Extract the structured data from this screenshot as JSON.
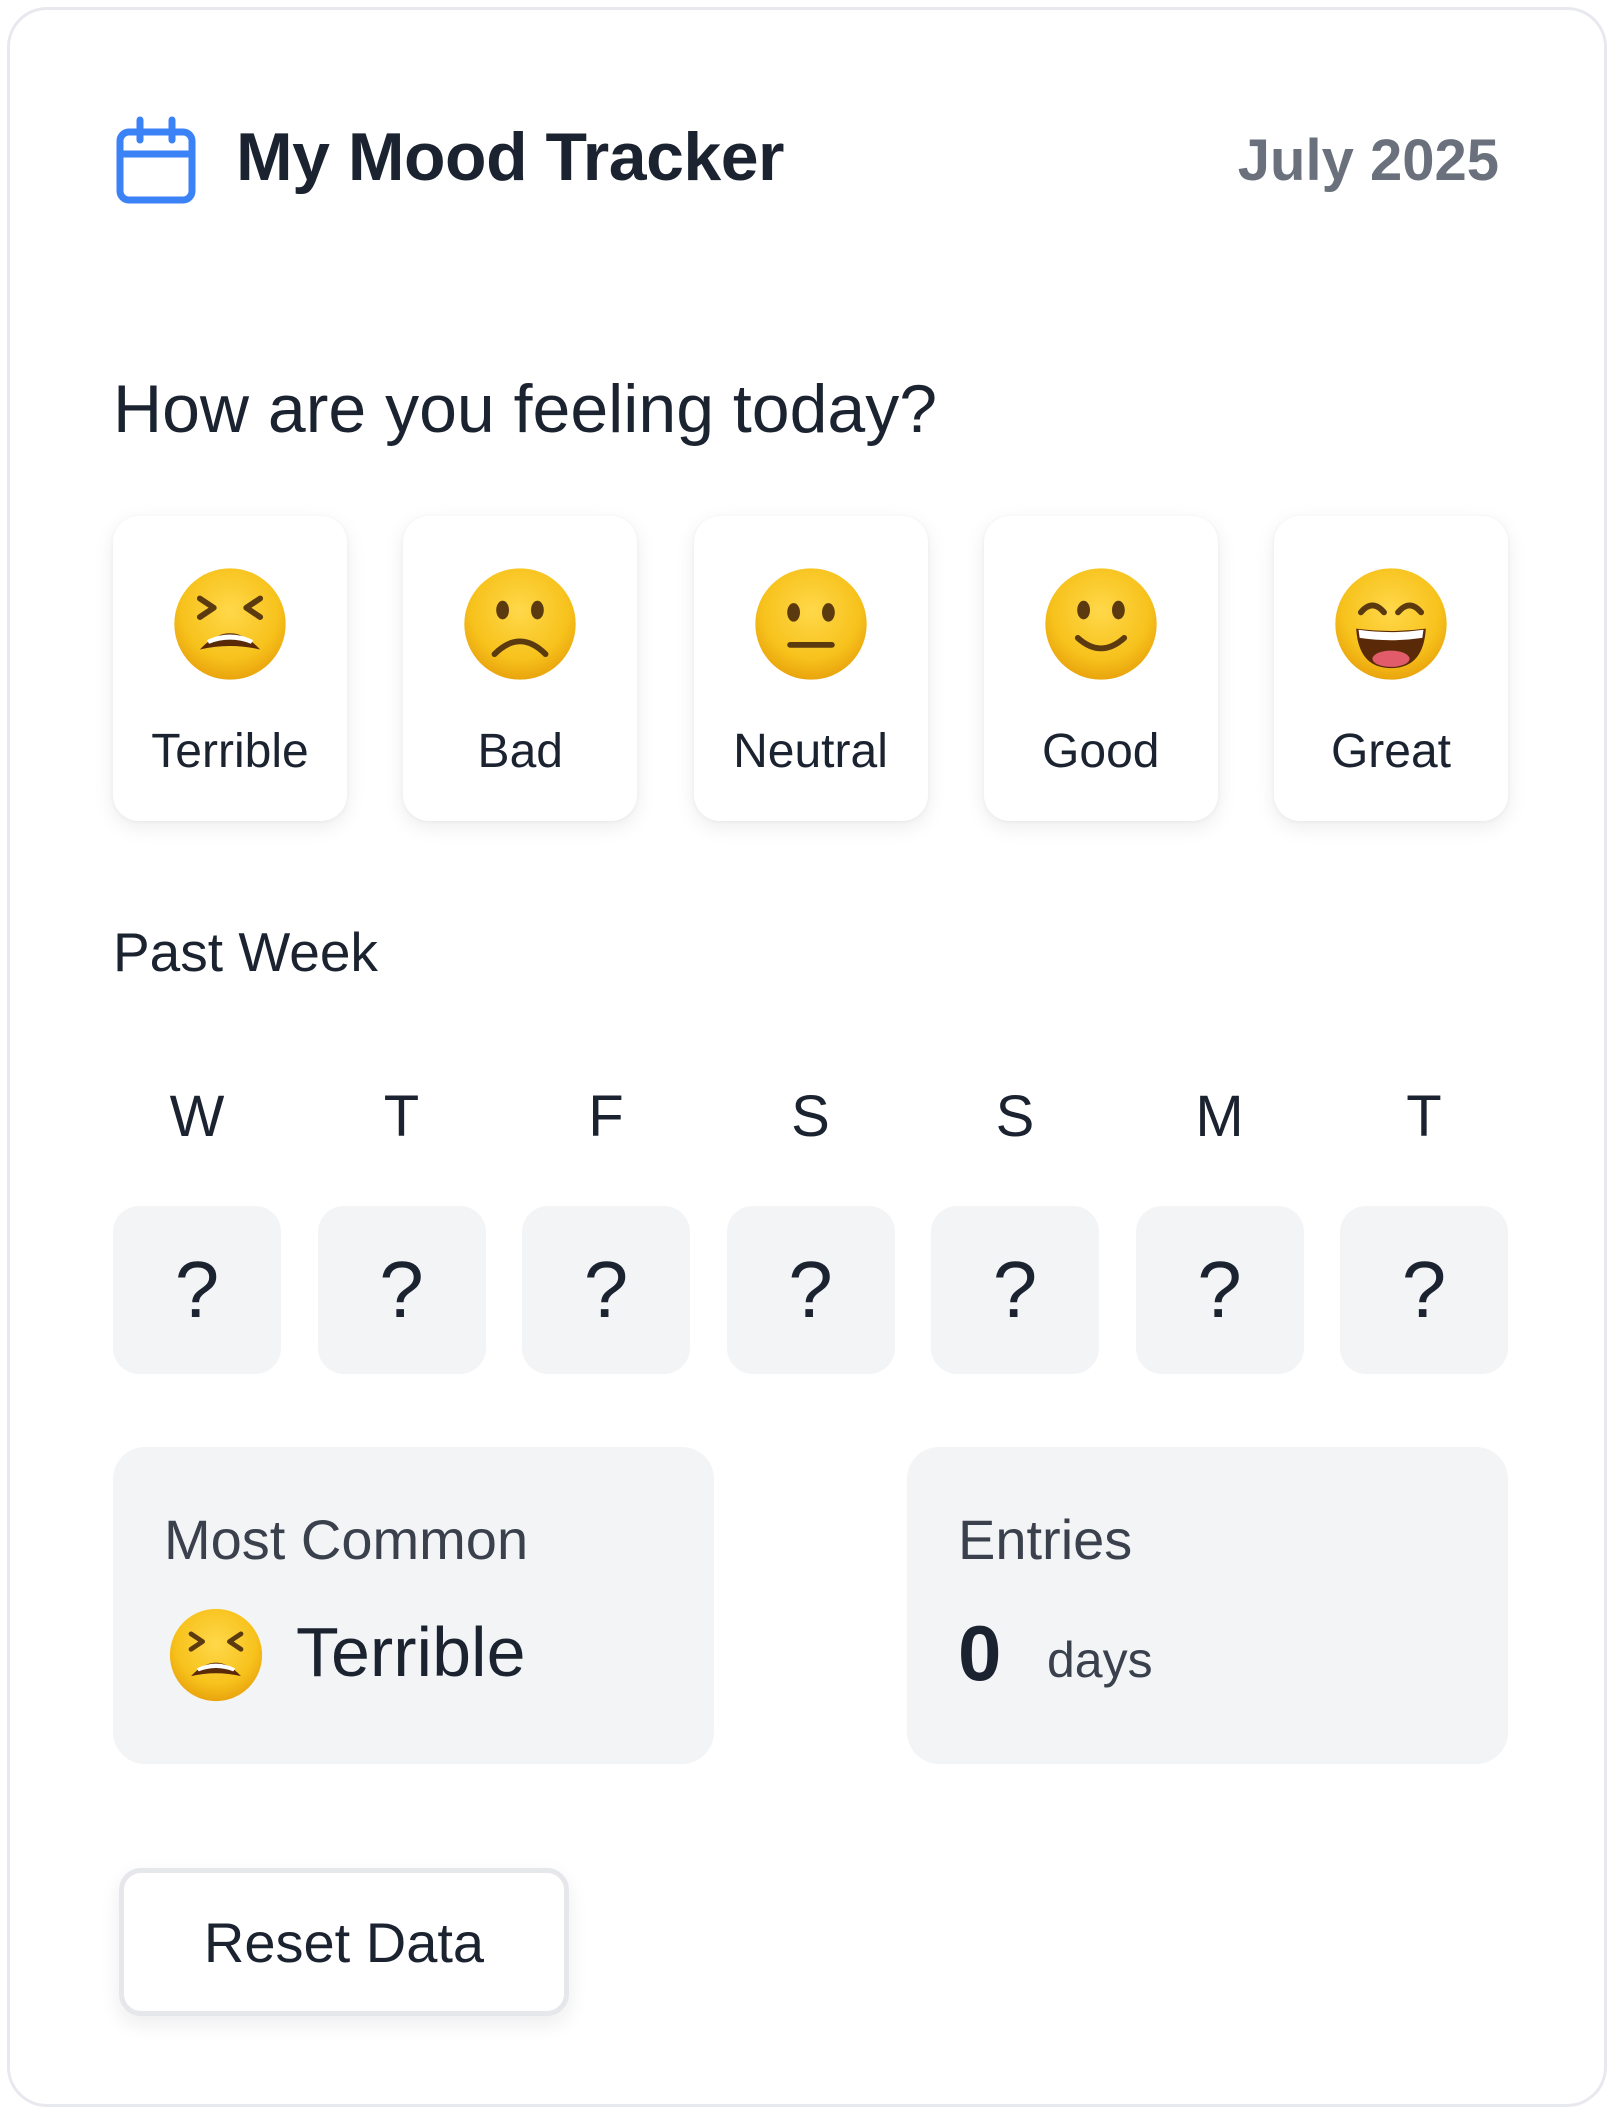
{
  "header": {
    "icon": "calendar-icon",
    "title": "My Mood Tracker",
    "date": "July 2025"
  },
  "question": "How are you feeling today?",
  "moods": [
    {
      "label": "Terrible",
      "icon": "tired-face-emoji"
    },
    {
      "label": "Bad",
      "icon": "frowning-face-emoji"
    },
    {
      "label": "Neutral",
      "icon": "neutral-face-emoji"
    },
    {
      "label": "Good",
      "icon": "slightly-smiling-face-emoji"
    },
    {
      "label": "Great",
      "icon": "grinning-face-emoji"
    }
  ],
  "past_week": {
    "title": "Past Week",
    "days": [
      {
        "letter": "W",
        "value": "?"
      },
      {
        "letter": "T",
        "value": "?"
      },
      {
        "letter": "F",
        "value": "?"
      },
      {
        "letter": "S",
        "value": "?"
      },
      {
        "letter": "S",
        "value": "?"
      },
      {
        "letter": "M",
        "value": "?"
      },
      {
        "letter": "T",
        "value": "?"
      }
    ]
  },
  "stats": {
    "most_common": {
      "label": "Most Common",
      "value": "Terrible",
      "icon": "tired-face-emoji"
    },
    "entries": {
      "label": "Entries",
      "count": "0",
      "unit": "days"
    }
  },
  "actions": {
    "reset_label": "Reset Data"
  },
  "colors": {
    "accent": "#3b82f6",
    "emoji_yellow": "#fbbf24",
    "cell_bg": "#f3f4f6",
    "text": "#1c2330",
    "muted": "#6b717c"
  }
}
